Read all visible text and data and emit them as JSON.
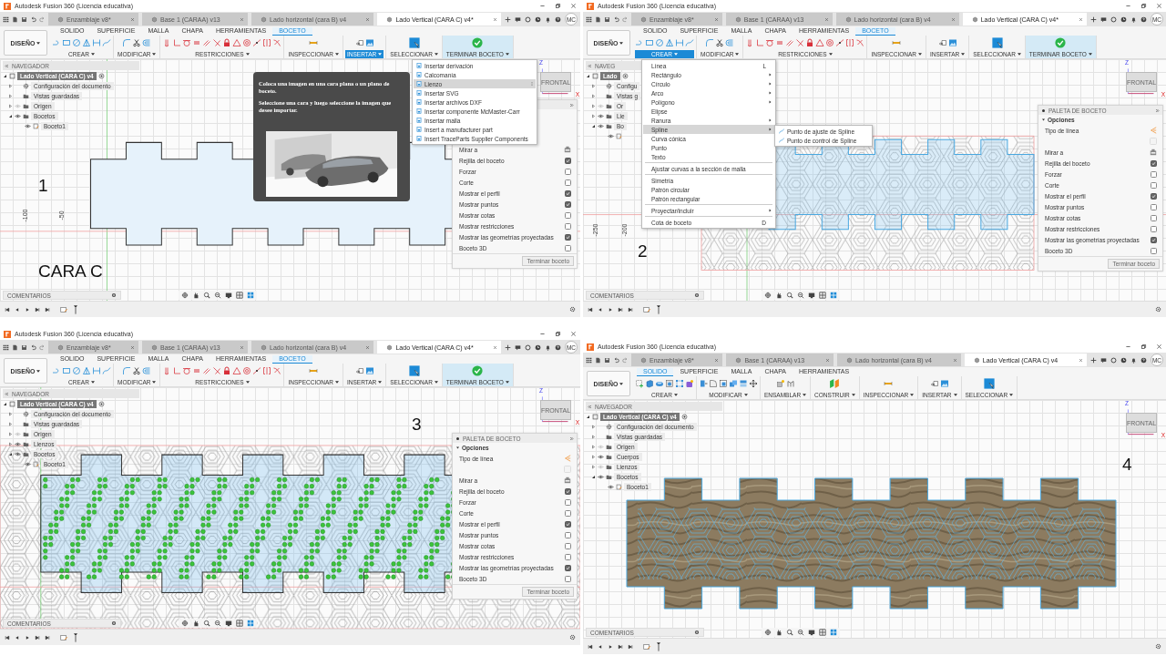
{
  "panels": [
    {
      "title": "Autodesk Fusion 360 (Licencia educativa)",
      "doc_tabs": [
        {
          "label": "Enzamblaje v8*",
          "selected": false
        },
        {
          "label": "Base 1  (CARAA) v13",
          "selected": false
        },
        {
          "label": "Lado horizontal  (cara B) v4",
          "selected": false
        },
        {
          "label": "Lado Vertical (CARA C) v4*",
          "selected": true
        }
      ],
      "user": "MC",
      "workspace": "DISEÑO",
      "ribbon": {
        "kind": "sketch",
        "tabs": [
          {
            "label": "SOLIDO",
            "selected": false
          },
          {
            "label": "SUPERFICIE",
            "selected": false
          },
          {
            "label": "MALLA",
            "selected": false
          },
          {
            "label": "CHAPA",
            "selected": false
          },
          {
            "label": "HERRAMIENTAS",
            "selected": false
          },
          {
            "label": "BOCETO",
            "selected": true
          }
        ],
        "groups": [
          {
            "label": "CREAR",
            "active": false
          },
          {
            "label": "MODIFICAR",
            "active": false
          },
          {
            "label": "RESTRICCIONES",
            "active": false
          },
          {
            "label": "INSPECCIONAR",
            "active": false
          },
          {
            "label": "INSERTAR",
            "active": true
          },
          {
            "label": "SELECCIONAR",
            "active": false
          },
          {
            "label": "TERMINAR BOCETO",
            "active": false
          }
        ]
      },
      "browser": {
        "title": "NAVEGADOR",
        "root": {
          "label": "Lado Vertical (CARA C) v4",
          "kind": "component",
          "expanded": true,
          "children": [
            {
              "label": "Configuración del documento",
              "kind": "settings",
              "expanded": false
            },
            {
              "label": "Vistas guardadas",
              "kind": "folder",
              "expanded": false
            },
            {
              "label": "Origen",
              "kind": "folder",
              "expanded": false,
              "visible": false
            },
            {
              "label": "Bocetos",
              "kind": "folder",
              "expanded": true,
              "visible": true,
              "children": [
                {
                  "label": "Boceto1",
                  "kind": "sketch",
                  "visible": true
                }
              ]
            }
          ]
        }
      },
      "drawing": {
        "kind": "sketch"
      },
      "axis_labels": [
        "-100",
        "-50"
      ],
      "captions": [
        "1",
        "CARA C"
      ],
      "viewcube": {
        "face": "FRONTAL",
        "axes": [
          "Z",
          "X"
        ]
      },
      "palette": {
        "rows": [
          {
            "kind": "look-at",
            "label": "Mirar a"
          },
          {
            "kind": "checkbox",
            "label": "Rejilla del boceto",
            "checked": true
          },
          {
            "kind": "checkbox",
            "label": "Forzar",
            "checked": false
          },
          {
            "kind": "checkbox",
            "label": "Corte",
            "checked": false
          },
          {
            "kind": "checkbox",
            "label": "Mostrar el perfil",
            "checked": true
          },
          {
            "kind": "checkbox",
            "label": "Mostrar puntos",
            "checked": true
          },
          {
            "kind": "checkbox",
            "label": "Mostrar cotas",
            "checked": false
          },
          {
            "kind": "checkbox",
            "label": "Mostrar restricciones",
            "checked": false
          },
          {
            "kind": "checkbox",
            "label": "Mostrar las geometrías proyectadas",
            "checked": true
          },
          {
            "kind": "checkbox",
            "label": "Boceto 3D",
            "checked": false
          }
        ],
        "button": "Terminar boceto"
      },
      "menu": {
        "kind": "insert",
        "items": [
          {
            "kind": "item",
            "label": "Insertar derivación",
            "selected": false
          },
          {
            "kind": "item",
            "label": "Calcomanía",
            "selected": false
          },
          {
            "kind": "item",
            "label": "Lienzo",
            "selected": true
          },
          {
            "kind": "item",
            "label": "Insertar SVG",
            "selected": false
          },
          {
            "kind": "item",
            "label": "Insertar archivos DXF",
            "selected": false
          },
          {
            "kind": "item",
            "label": "Insertar componente McMaster-Carr",
            "selected": false
          },
          {
            "kind": "item",
            "label": "Insertar malla",
            "selected": false
          },
          {
            "kind": "item",
            "label": "Insert a manufacturer part",
            "selected": false
          },
          {
            "kind": "item",
            "label": "Insert TraceParts Supplier Components",
            "selected": false
          }
        ]
      },
      "tooltip": {
        "lines": [
          "Coloca una imagen en una cara plana o un plano de boceto.",
          "Seleccione una cara y luego seleccione la imagen que desee importar."
        ],
        "kind": "picture"
      },
      "comments": "COMENTARIOS"
    },
    {
      "title": "Autodesk Fusion 360 (Licencia educativa)",
      "doc_tabs": [
        {
          "label": "Enzamblaje v8*",
          "selected": false
        },
        {
          "label": "Base 1  (CARAA) v13",
          "selected": false
        },
        {
          "label": "Lado horizontal  (cara B) v4",
          "selected": false
        },
        {
          "label": "Lado Vertical (CARA C) v4*",
          "selected": true
        }
      ],
      "user": "MC",
      "workspace": "DISEÑO",
      "ribbon": {
        "kind": "sketch",
        "tabs": [
          {
            "label": "SOLIDO",
            "selected": false
          },
          {
            "label": "SUPERFICIE",
            "selected": false
          },
          {
            "label": "MALLA",
            "selected": false
          },
          {
            "label": "CHAPA",
            "selected": false
          },
          {
            "label": "HERRAMIENTAS",
            "selected": false
          },
          {
            "label": "BOCETO",
            "selected": true
          }
        ],
        "groups": [
          {
            "label": "CREAR",
            "active": true
          },
          {
            "label": "MODIFICAR",
            "active": false
          },
          {
            "label": "RESTRICCIONES",
            "active": false
          },
          {
            "label": "INSPECCIONAR",
            "active": false
          },
          {
            "label": "INSERTAR",
            "active": false
          },
          {
            "label": "SELECCIONAR",
            "active": false
          },
          {
            "label": "TERMINAR BOCETO",
            "active": false
          }
        ]
      },
      "browser": {
        "title": "NAVEG",
        "root": {
          "label": "Lado",
          "kind": "component",
          "expanded": true,
          "children": [
            {
              "label": "Configu",
              "kind": "settings",
              "expanded": false
            },
            {
              "label": "Vistas g",
              "kind": "folder",
              "expanded": false
            },
            {
              "label": "Or",
              "kind": "folder",
              "expanded": false,
              "visible": false
            },
            {
              "label": "Lie",
              "kind": "folder",
              "expanded": false,
              "visible": true
            },
            {
              "label": "Bo",
              "kind": "folder",
              "expanded": true,
              "visible": true,
              "children": [
                {
                  "kind": "sketch",
                  "visible": true
                }
              ]
            }
          ]
        }
      },
      "drawing": {
        "kind": "canvas-sketch"
      },
      "axis_labels": [
        "-250",
        "-200"
      ],
      "captions": [
        "2"
      ],
      "viewcube": {
        "face": "FRONTAL",
        "axes": [
          "Z",
          "X"
        ]
      },
      "palette": {
        "title": "PALETA DE BOCETO",
        "section": "Opciones",
        "rows": [
          {
            "kind": "line-type",
            "label": "Tipo de línea"
          },
          {
            "kind": "toggle",
            "disabled": true
          },
          {
            "kind": "look-at",
            "label": "Mirar a"
          },
          {
            "kind": "checkbox",
            "label": "Rejilla del boceto",
            "checked": true
          },
          {
            "kind": "checkbox",
            "label": "Forzar",
            "checked": false
          },
          {
            "kind": "checkbox",
            "label": "Corte",
            "checked": false
          },
          {
            "kind": "checkbox",
            "label": "Mostrar el perfil",
            "checked": true
          },
          {
            "kind": "checkbox",
            "label": "Mostrar puntos",
            "checked": false
          },
          {
            "kind": "checkbox",
            "label": "Mostrar cotas",
            "checked": false
          },
          {
            "kind": "checkbox",
            "label": "Mostrar restricciones",
            "checked": false
          },
          {
            "kind": "checkbox",
            "label": "Mostrar las geometrías proyectadas",
            "checked": true
          },
          {
            "kind": "checkbox",
            "label": "Boceto 3D",
            "checked": false
          }
        ],
        "button": "Terminar boceto"
      },
      "menu": {
        "kind": "create",
        "items": [
          {
            "kind": "item",
            "label": "Línea",
            "shortcut": "L",
            "submenu": false,
            "selected": false
          },
          {
            "kind": "item",
            "label": "Rectángulo",
            "submenu": true,
            "selected": false
          },
          {
            "kind": "item",
            "label": "Círculo",
            "submenu": true,
            "selected": false
          },
          {
            "kind": "item",
            "label": "Arco",
            "submenu": true,
            "selected": false
          },
          {
            "kind": "item",
            "label": "Polígono",
            "submenu": true,
            "selected": false
          },
          {
            "kind": "item",
            "label": "Elipse",
            "submenu": false,
            "selected": false
          },
          {
            "kind": "item",
            "label": "Ranura",
            "submenu": true,
            "selected": false
          },
          {
            "kind": "item",
            "label": "Spline",
            "submenu": true,
            "selected": true
          },
          {
            "kind": "item",
            "label": "Curva cónica",
            "submenu": false,
            "selected": false
          },
          {
            "kind": "item",
            "label": "Punto",
            "submenu": false,
            "selected": false
          },
          {
            "kind": "item",
            "label": "Texto",
            "submenu": false,
            "selected": false
          },
          {
            "kind": "separator"
          },
          {
            "kind": "item",
            "label": "Ajustar curvas a la sección de malla",
            "submenu": false,
            "selected": false
          },
          {
            "kind": "separator"
          },
          {
            "kind": "item",
            "label": "Simetría",
            "submenu": false,
            "selected": false
          },
          {
            "kind": "item",
            "label": "Patrón circular",
            "submenu": false,
            "selected": false
          },
          {
            "kind": "item",
            "label": "Patrón rectangular",
            "submenu": false,
            "selected": false
          },
          {
            "kind": "separator"
          },
          {
            "kind": "item",
            "label": "Proyectar/incluir",
            "submenu": true,
            "selected": false
          },
          {
            "kind": "separator"
          },
          {
            "kind": "item",
            "label": "Cota de boceto",
            "shortcut": "D",
            "submenu": false,
            "selected": false
          }
        ],
        "submenu": [
          {
            "label": "Punto de ajuste de Spline"
          },
          {
            "label": "Punto de control de Spline"
          }
        ]
      },
      "comments": "COMENTARIOS"
    },
    {
      "title": "Autodesk Fusion 360 (Licencia educativa)",
      "doc_tabs": [
        {
          "label": "Enzamblaje v8*",
          "selected": false
        },
        {
          "label": "Base 1  (CARAA) v13",
          "selected": false
        },
        {
          "label": "Lado horizontal  (cara B) v4",
          "selected": false
        },
        {
          "label": "Lado Vertical (CARA C) v4*",
          "selected": true
        }
      ],
      "user": "MC",
      "workspace": "DISEÑO",
      "ribbon": {
        "kind": "sketch",
        "tabs": [
          {
            "label": "SOLIDO",
            "selected": false
          },
          {
            "label": "SUPERFICIE",
            "selected": false
          },
          {
            "label": "MALLA",
            "selected": false
          },
          {
            "label": "CHAPA",
            "selected": false
          },
          {
            "label": "HERRAMIENTAS",
            "selected": false
          },
          {
            "label": "BOCETO",
            "selected": true
          }
        ],
        "groups": [
          {
            "label": "CREAR",
            "active": false
          },
          {
            "label": "MODIFICAR",
            "active": false
          },
          {
            "label": "RESTRICCIONES",
            "active": false
          },
          {
            "label": "INSPECCIONAR",
            "active": false
          },
          {
            "label": "INSERTAR",
            "active": false
          },
          {
            "label": "SELECCIONAR",
            "active": false
          },
          {
            "label": "TERMINAR BOCETO",
            "active": false
          }
        ]
      },
      "browser": {
        "title": "NAVEGADOR",
        "root": {
          "label": "Lado Vertical (CARA C) v4",
          "kind": "component",
          "expanded": true,
          "children": [
            {
              "label": "Configuración del documento",
              "kind": "settings",
              "expanded": false
            },
            {
              "label": "Vistas guardadas",
              "kind": "folder",
              "expanded": false
            },
            {
              "label": "Origen",
              "kind": "folder",
              "expanded": false,
              "visible": false
            },
            {
              "label": "Lienzos",
              "kind": "folder",
              "expanded": false,
              "visible": true
            },
            {
              "label": "Bocetos",
              "kind": "folder",
              "expanded": true,
              "visible": true,
              "children": [
                {
                  "label": "Boceto1",
                  "kind": "sketch",
                  "visible": true
                }
              ]
            }
          ]
        }
      },
      "drawing": {
        "kind": "canvas-points"
      },
      "captions": [
        "3"
      ],
      "viewcube": {
        "face": "FRONTAL",
        "axes": [
          "Z",
          "X"
        ]
      },
      "palette": {
        "title": "PALETA DE BOCETO",
        "section": "Opciones",
        "rows": [
          {
            "kind": "line-type",
            "label": "Tipo de línea"
          },
          {
            "kind": "toggle",
            "disabled": true
          },
          {
            "kind": "look-at",
            "label": "Mirar a"
          },
          {
            "kind": "checkbox",
            "label": "Rejilla del boceto",
            "checked": true
          },
          {
            "kind": "checkbox",
            "label": "Forzar",
            "checked": false
          },
          {
            "kind": "checkbox",
            "label": "Corte",
            "checked": false
          },
          {
            "kind": "checkbox",
            "label": "Mostrar el perfil",
            "checked": true
          },
          {
            "kind": "checkbox",
            "label": "Mostrar puntos",
            "checked": false
          },
          {
            "kind": "checkbox",
            "label": "Mostrar cotas",
            "checked": false
          },
          {
            "kind": "checkbox",
            "label": "Mostrar restricciones",
            "checked": false
          },
          {
            "kind": "checkbox",
            "label": "Mostrar las geometrías proyectadas",
            "checked": true
          },
          {
            "kind": "checkbox",
            "label": "Boceto 3D",
            "checked": false
          }
        ],
        "button": "Terminar boceto"
      },
      "comments": "COMENTARIOS"
    },
    {
      "title": "Autodesk Fusion 360 (Licencia educativa)",
      "doc_tabs": [
        {
          "label": "Enzamblaje v8*",
          "selected": false
        },
        {
          "label": "Base 1  (CARAA) v13",
          "selected": false
        },
        {
          "label": "Lado horizontal  (cara B) v4",
          "selected": false
        },
        {
          "label": "Lado Vertical (CARA C) v4",
          "selected": true
        }
      ],
      "user": "MC",
      "workspace": "DISEÑO",
      "ribbon": {
        "kind": "solid",
        "tabs": [
          {
            "label": "SOLIDO",
            "selected": true
          },
          {
            "label": "SUPERFICIE",
            "selected": false
          },
          {
            "label": "MALLA",
            "selected": false
          },
          {
            "label": "CHAPA",
            "selected": false
          },
          {
            "label": "HERRAMIENTAS",
            "selected": false
          }
        ],
        "groups": [
          {
            "label": "CREAR",
            "active": false
          },
          {
            "label": "MODIFICAR",
            "active": false
          },
          {
            "label": "ENSAMBLAR",
            "active": false
          },
          {
            "label": "CONSTRUIR",
            "active": false
          },
          {
            "label": "INSPECCIONAR",
            "active": false
          },
          {
            "label": "INSERTAR",
            "active": false
          },
          {
            "label": "SELECCIONAR",
            "active": false
          }
        ]
      },
      "browser": {
        "title": "NAVEGADOR",
        "root": {
          "label": "Lado Vertical (CARA C) v4",
          "kind": "component",
          "expanded": true,
          "children": [
            {
              "label": "Configuración del documento",
              "kind": "settings",
              "expanded": false
            },
            {
              "label": "Vistas guardadas",
              "kind": "folder",
              "expanded": false
            },
            {
              "label": "Origen",
              "kind": "folder",
              "expanded": false,
              "visible": false
            },
            {
              "label": "Cuerpos",
              "kind": "folder",
              "expanded": false,
              "visible": true
            },
            {
              "label": "Lienzos",
              "kind": "folder",
              "expanded": false,
              "visible": false
            },
            {
              "label": "Bocetos",
              "kind": "folder",
              "expanded": true,
              "visible": true,
              "children": [
                {
                  "label": "Boceto1",
                  "kind": "sketch",
                  "visible": true
                }
              ]
            }
          ]
        }
      },
      "drawing": {
        "kind": "wood-body"
      },
      "captions": [
        "4"
      ],
      "viewcube": {
        "face": "FRONTAL",
        "axes": [
          "Z",
          "X"
        ]
      },
      "comments": "COMENTARIOS"
    }
  ]
}
